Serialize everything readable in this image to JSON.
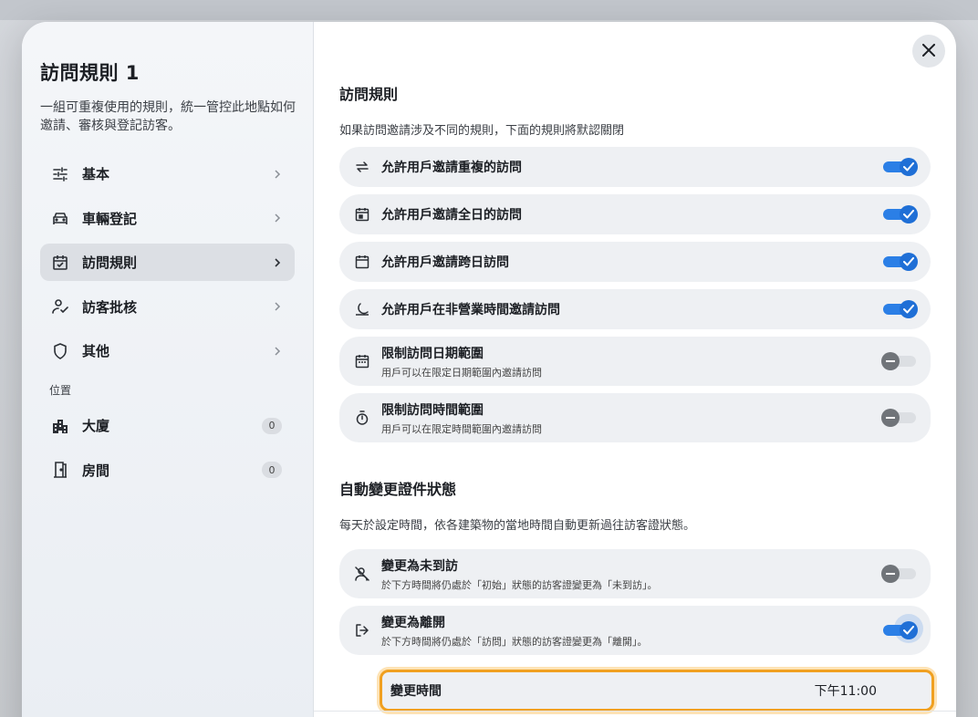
{
  "sidebar": {
    "title": "訪問規則 1",
    "description": "一組可重複使用的規則，統一管控此地點如何邀請、審核與登記訪客。",
    "items": [
      {
        "label": "基本",
        "icon": "sliders-icon"
      },
      {
        "label": "車輛登記",
        "icon": "car-icon"
      },
      {
        "label": "訪問規則",
        "icon": "calendar-check-icon"
      },
      {
        "label": "訪客批核",
        "icon": "user-check-icon"
      },
      {
        "label": "其他",
        "icon": "shield-icon"
      }
    ],
    "location_section": "位置",
    "locations": [
      {
        "label": "大廈",
        "count": "0",
        "icon": "building-icon"
      },
      {
        "label": "房間",
        "count": "0",
        "icon": "door-icon"
      }
    ]
  },
  "main": {
    "rules_heading": "訪問規則",
    "rules_hint": "如果訪問邀請涉及不同的規則，下面的規則將默認關閉",
    "rules": [
      {
        "title": "允許用戶邀請重複的訪問",
        "subtitle": "",
        "on": true,
        "icon": "repeat-icon"
      },
      {
        "title": "允許用戶邀請全日的訪問",
        "subtitle": "",
        "on": true,
        "icon": "calendar-day-icon"
      },
      {
        "title": "允許用戶邀請跨日訪問",
        "subtitle": "",
        "on": true,
        "icon": "calendar-icon"
      },
      {
        "title": "允許用戶在非營業時間邀請訪問",
        "subtitle": "",
        "on": true,
        "icon": "moon-icon"
      },
      {
        "title": "限制訪問日期範圍",
        "subtitle": "用戶可以在限定日期範圍內邀請訪問",
        "on": false,
        "icon": "calendar-range-icon"
      },
      {
        "title": "限制訪問時間範圍",
        "subtitle": "用戶可以在限定時間範圍內邀請訪問",
        "on": false,
        "icon": "timer-icon"
      }
    ],
    "auto_heading": "自動變更證件狀態",
    "auto_hint": "每天於設定時間，依各建築物的當地時間自動更新過往訪客證狀態。",
    "auto_rules": [
      {
        "title": "變更為未到訪",
        "subtitle": "於下方時間將仍處於「初始」狀態的訪客證變更為「未到訪」。",
        "on": false,
        "icon": "user-off-icon"
      },
      {
        "title": "變更為離開",
        "subtitle": "於下方時間將仍處於「訪問」狀態的訪客證變更為「離開」。",
        "on": true,
        "icon": "logout-icon"
      }
    ],
    "change_time_label": "變更時間",
    "change_time_value": "下午11:00"
  },
  "colors": {
    "accent": "#1f6fd6",
    "focus": "#f0a020"
  }
}
